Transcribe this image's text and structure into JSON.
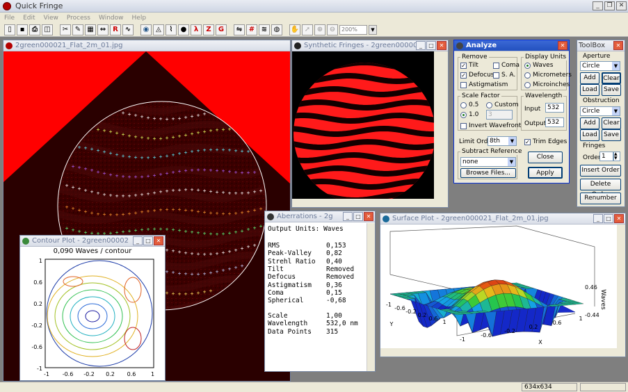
{
  "app": {
    "title": "Quick Fringe"
  },
  "menu": [
    "File",
    "Edit",
    "View",
    "Process",
    "Window",
    "Help"
  ],
  "toolbar": {
    "zoom": "200%"
  },
  "status": {
    "size": "634x634"
  },
  "image_window": {
    "title": "2green000021_Flat_2m_01.jpg"
  },
  "synthetic_window": {
    "title": "Synthetic Fringes - 2green0000021_"
  },
  "contour_window": {
    "title": "Contour Plot - 2green000021_",
    "caption": "0,090 Waves / contour",
    "y_ticks": [
      "1",
      "0.6",
      "0.2",
      "-0.2",
      "-0.6",
      "-1"
    ],
    "x_ticks": [
      "-1",
      "-0.6",
      "-0.2",
      "0.2",
      "0.6",
      "1"
    ]
  },
  "aberrations_window": {
    "title": "Aberrations - 2gr",
    "header": "Output Units: Waves",
    "rows": [
      {
        "k": "RMS",
        "v": "0,153"
      },
      {
        "k": "Peak-Valley",
        "v": "0,82"
      },
      {
        "k": "Strehl Ratio",
        "v": "0,40"
      },
      {
        "k": "Tilt",
        "v": "Removed"
      },
      {
        "k": "Defocus",
        "v": "Removed"
      },
      {
        "k": "Astigmatism",
        "v": "0,36"
      },
      {
        "k": "Coma",
        "v": "0,15"
      },
      {
        "k": "Spherical",
        "v": "-0,68"
      }
    ],
    "rows2": [
      {
        "k": "Scale",
        "v": "1,00"
      },
      {
        "k": "Wavelength",
        "v": "532,0 nm"
      },
      {
        "k": "Data Points",
        "v": "315"
      }
    ]
  },
  "surface_window": {
    "title": "Surface Plot - 2green000021_Flat_2m_01.jpg",
    "z_ticks": [
      "0.46",
      "-0.44"
    ],
    "z_label": "Waves",
    "x_label": "X",
    "y_label": "Y",
    "y_ticks": [
      "-1",
      "-0.6",
      "-0.2",
      "0.2",
      "0.6",
      "1"
    ],
    "x_ticks": [
      "-1",
      "-0.6",
      "-0.2",
      "0.2",
      "0.6",
      "1"
    ]
  },
  "analyze": {
    "title": "Analyze",
    "remove_label": "Remove",
    "tilt": "Tilt",
    "coma": "Coma",
    "defocus": "Defocus",
    "sa": "S. A.",
    "astigmatism": "Astigmatism",
    "display_units_label": "Display Units",
    "waves": "Waves",
    "micrometers": "Micrometers",
    "microinches": "Microinches",
    "scale_label": "Scale Factor",
    "s05": "0.5",
    "custom": "Custom",
    "s10": "1.0",
    "custom_value": "3",
    "invert": "Invert Wavefront",
    "wavelength_label": "Wavelength",
    "input_label": "Input",
    "input_value": "532",
    "output_label": "Output",
    "output_value": "532",
    "limit_order_label": "Limit Order",
    "limit_order_value": "8th",
    "trim_edges": "Trim Edges",
    "subtract_label": "Subtract Reference",
    "subtract_value": "none",
    "browse": "Browse Files...",
    "close": "Close",
    "apply": "Apply"
  },
  "toolbox": {
    "title": "ToolBox",
    "aperture_label": "Aperture",
    "aperture_value": "Circle",
    "add": "Add",
    "clear": "Clear",
    "load": "Load",
    "save": "Save",
    "obstruction_label": "Obstruction",
    "obstruction_value": "Circle",
    "fringes_label": "Fringes",
    "order_label": "Order",
    "order_value": "1",
    "insert_order": "Insert Order",
    "delete_order": "Delete Order",
    "renumber": "Renumber"
  },
  "colors": {
    "title_active": "#2351bf",
    "fringe_red": "#ff1a1a",
    "image_bg": "#ff0000"
  }
}
